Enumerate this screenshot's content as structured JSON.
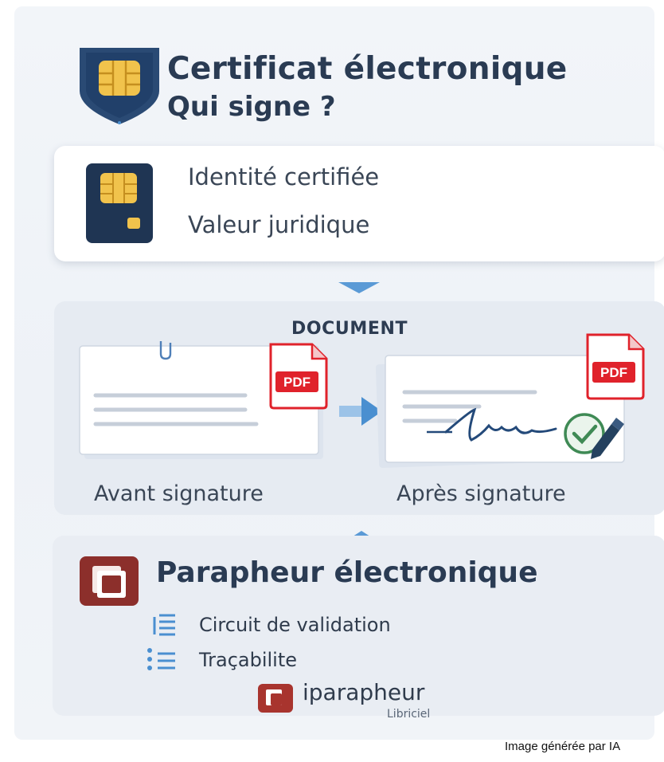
{
  "header": {
    "title_line1": "Certificat électronique",
    "title_line2": "Qui signe ?"
  },
  "identity": {
    "line1": "Identité certifiée",
    "line2": "Valeur juridique"
  },
  "document": {
    "title": "DOCUMENT",
    "before_label": "Avant signature",
    "after_label": "Après signature",
    "badge_text": "PDF"
  },
  "parapheur": {
    "title": "Parapheur électronique",
    "items": [
      "Circuit de validation",
      "Traçabilite"
    ],
    "product_name": "iparapheur",
    "product_vendor": "Libriciel"
  },
  "footer": {
    "credit": "Image générée par IA"
  },
  "icons": {
    "shield": "shield-chip-icon",
    "card": "smart-card-icon",
    "pdf": "pdf-file-icon",
    "check": "check-circle-icon",
    "pen": "pen-icon",
    "logo": "stacked-squares-logo-icon",
    "list": "list-icon"
  },
  "colors": {
    "navy": "#2a3b53",
    "gold": "#e8b93c",
    "pdf_red": "#e0222b",
    "logo_red": "#8c2f2b",
    "check_green": "#3f8a55",
    "arrow_blue": "#4a8fd0"
  }
}
